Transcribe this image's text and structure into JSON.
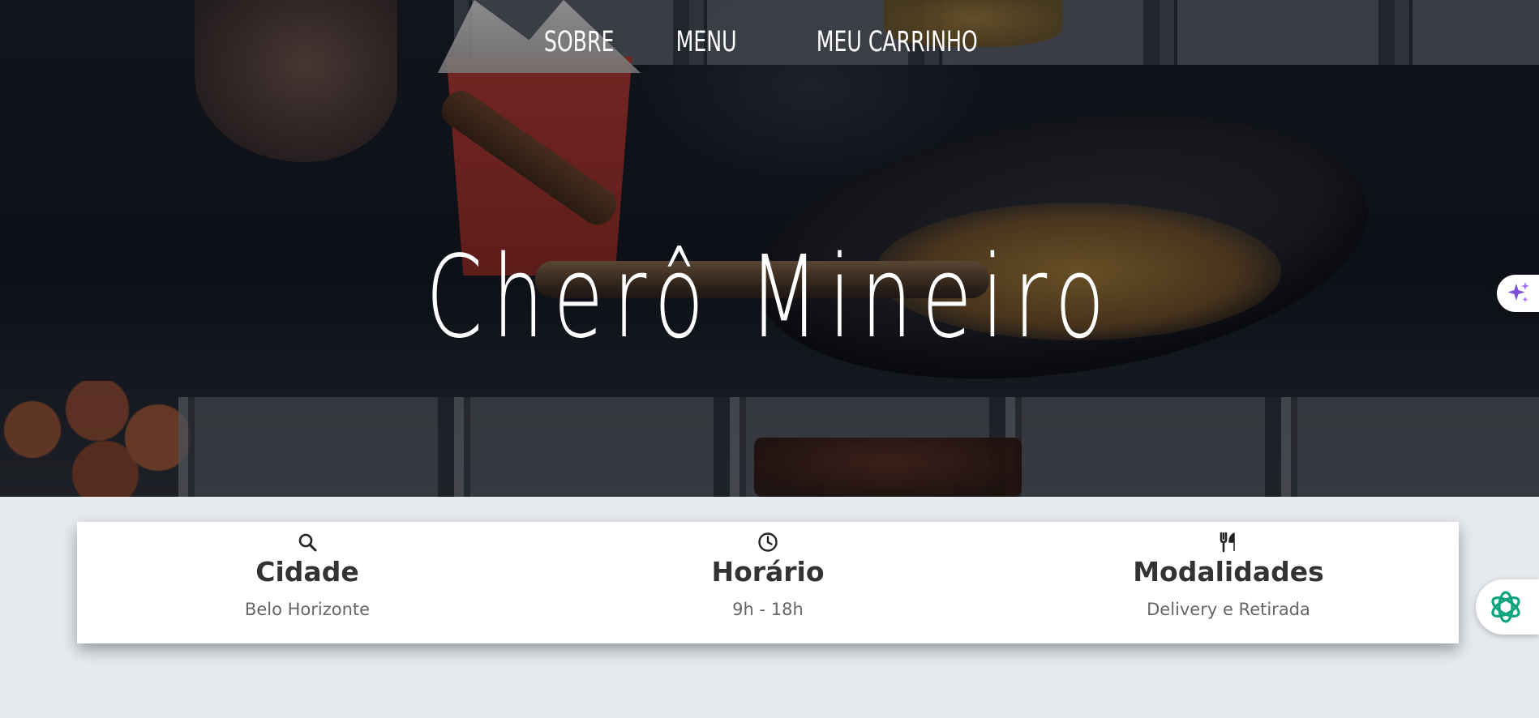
{
  "nav": {
    "items": [
      {
        "label": "SOBRE"
      },
      {
        "label": "MENU"
      },
      {
        "label": "MEU CARRINHO"
      }
    ]
  },
  "hero": {
    "title": "Cherô Mineiro"
  },
  "info": {
    "items": [
      {
        "icon": "search-icon",
        "title": "Cidade",
        "text": "Belo Horizonte"
      },
      {
        "icon": "clock-icon",
        "title": "Horário",
        "text": "9h - 18h"
      },
      {
        "icon": "utensils-icon",
        "title": "Modalidades",
        "text": "Delivery e Retirada"
      }
    ]
  },
  "colors": {
    "page_background": "#e7ebef",
    "card_background": "#ffffff",
    "title_text": "#333333",
    "body_text": "#666666",
    "ai_accent": "#7b4fd6",
    "assistant_accent": "#10a37f"
  }
}
